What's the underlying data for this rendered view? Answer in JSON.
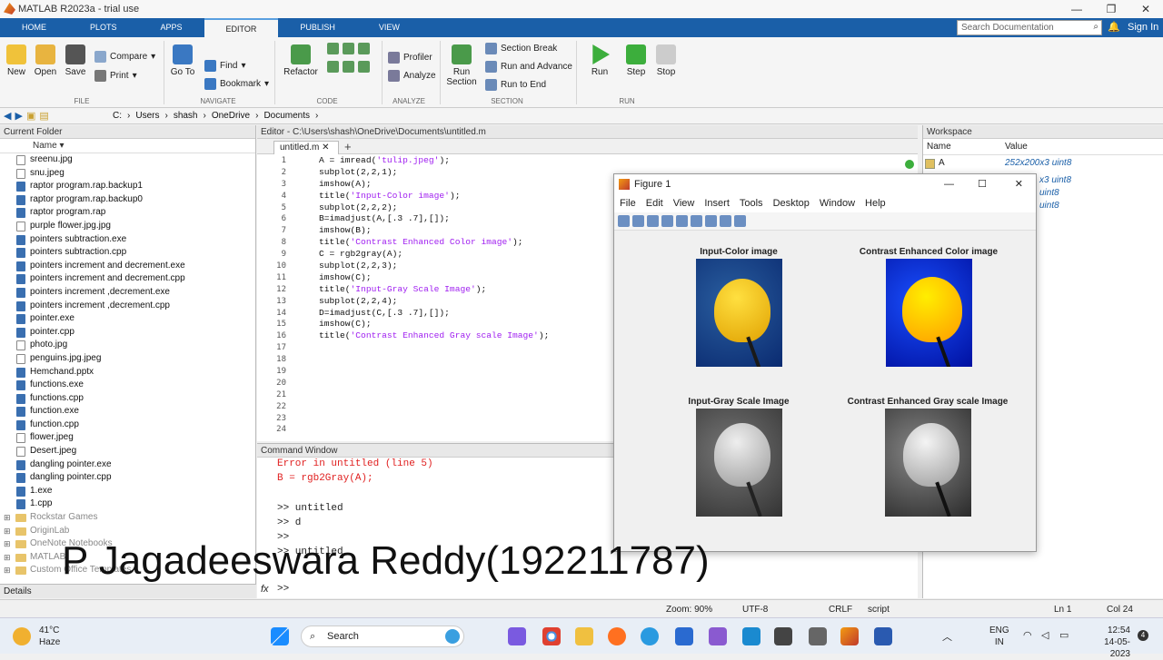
{
  "app": {
    "title": "MATLAB R2023a - trial use"
  },
  "tabs": [
    "HOME",
    "PLOTS",
    "APPS",
    "EDITOR",
    "PUBLISH",
    "VIEW"
  ],
  "search": {
    "placeholder": "Search Documentation"
  },
  "signin": "Sign In",
  "ribbon": {
    "new": "New",
    "open": "Open",
    "save": "Save",
    "compare": "Compare",
    "print": "Print",
    "goto": "Go To",
    "find": "Find",
    "bookmark": "Bookmark",
    "refactor": "Refactor",
    "profiler": "Profiler",
    "analyze": "Analyze",
    "run_section": "Run Section",
    "section_break": "Section Break",
    "run_advance": "Run and Advance",
    "run_end": "Run to End",
    "run": "Run",
    "step": "Step",
    "stop": "Stop",
    "sections": [
      "FILE",
      "NAVIGATE",
      "CODE",
      "ANALYZE",
      "SECTION",
      "RUN"
    ]
  },
  "path": [
    "C:",
    "Users",
    "shash",
    "OneDrive",
    "Documents"
  ],
  "current_folder": {
    "title": "Current Folder",
    "col": "Name",
    "files": [
      "sreenu.jpg",
      "snu.jpeg",
      "raptor program.rap.backup1",
      "raptor program.rap.backup0",
      "raptor program.rap",
      "purple flower.jpg.jpg",
      "pointers subtraction.exe",
      "pointers subtraction.cpp",
      "pointers increment and decrement.exe",
      "pointers increment and decrement.cpp",
      "pointers increment ,decrement.exe",
      "pointers increment ,decrement.cpp",
      "pointer.exe",
      "pointer.cpp",
      "photo.jpg",
      "penguins.jpg.jpeg",
      "Hemchand.pptx",
      "functions.exe",
      "functions.cpp",
      "function.exe",
      "function.cpp",
      "flower.jpeg",
      "Desert.jpeg",
      "dangling pointer.exe",
      "dangling pointer.cpp",
      "1.exe",
      "1.cpp"
    ],
    "folders": [
      "Rockstar Games",
      "OriginLab",
      "OneNote Notebooks",
      "MATLAB",
      "Custom Office Templates"
    ]
  },
  "details": "Details",
  "editor": {
    "header": "Editor - C:\\Users\\shash\\OneDrive\\Documents\\untitled.m",
    "tab": "untitled.m",
    "lines": [
      "A = imread('tulip.jpeg');",
      "subplot(2,2,1);",
      "imshow(A);",
      "title('Input-Color image');",
      "subplot(2,2,2);",
      "B=imadjust(A,[.3 .7],[]);",
      "imshow(B);",
      "title('Contrast Enhanced Color image');",
      "C = rgb2gray(A);",
      "subplot(2,2,3);",
      "imshow(C);",
      "title('Input-Gray Scale Image');",
      "subplot(2,2,4);",
      "D=imadjust(C,[.3 .7],[]);",
      "imshow(C);",
      "title('Contrast Enhanced Gray scale Image');",
      "",
      "",
      "",
      "",
      "",
      "",
      "",
      ""
    ]
  },
  "command": {
    "title": "Command Window",
    "lines": [
      "Error in untitled (line 5)",
      "B = rgb2Gray(A);",
      "",
      ">> untitled",
      ">> d",
      ">>",
      ">> untitled"
    ],
    "prompt": ">>"
  },
  "workspace": {
    "title": "Workspace",
    "col_name": "Name",
    "col_value": "Value",
    "rows": [
      {
        "name": "A",
        "value": "252x200x3 uint8"
      }
    ],
    "partial": [
      "x3 uint8",
      "uint8",
      "uint8"
    ]
  },
  "figure": {
    "title": "Figure 1",
    "menu": [
      "File",
      "Edit",
      "View",
      "Insert",
      "Tools",
      "Desktop",
      "Window",
      "Help"
    ],
    "plots": [
      "Input-Color image",
      "Contrast Enhanced Color image",
      "Input-Gray Scale Image",
      "Contrast Enhanced Gray scale Image"
    ]
  },
  "watermark": "P Jagadeeswara Reddy(192211787)",
  "status": {
    "zoom": "Zoom: 90%",
    "encoding": "UTF-8",
    "eol": "CRLF",
    "type": "script",
    "ln": "Ln  1",
    "col": "Col  24"
  },
  "taskbar": {
    "weather_temp": "41°C",
    "weather_desc": "Haze",
    "search": "Search",
    "lang1": "ENG",
    "lang2": "IN",
    "time": "12:54",
    "date": "14-05-2023",
    "badge": "4"
  }
}
